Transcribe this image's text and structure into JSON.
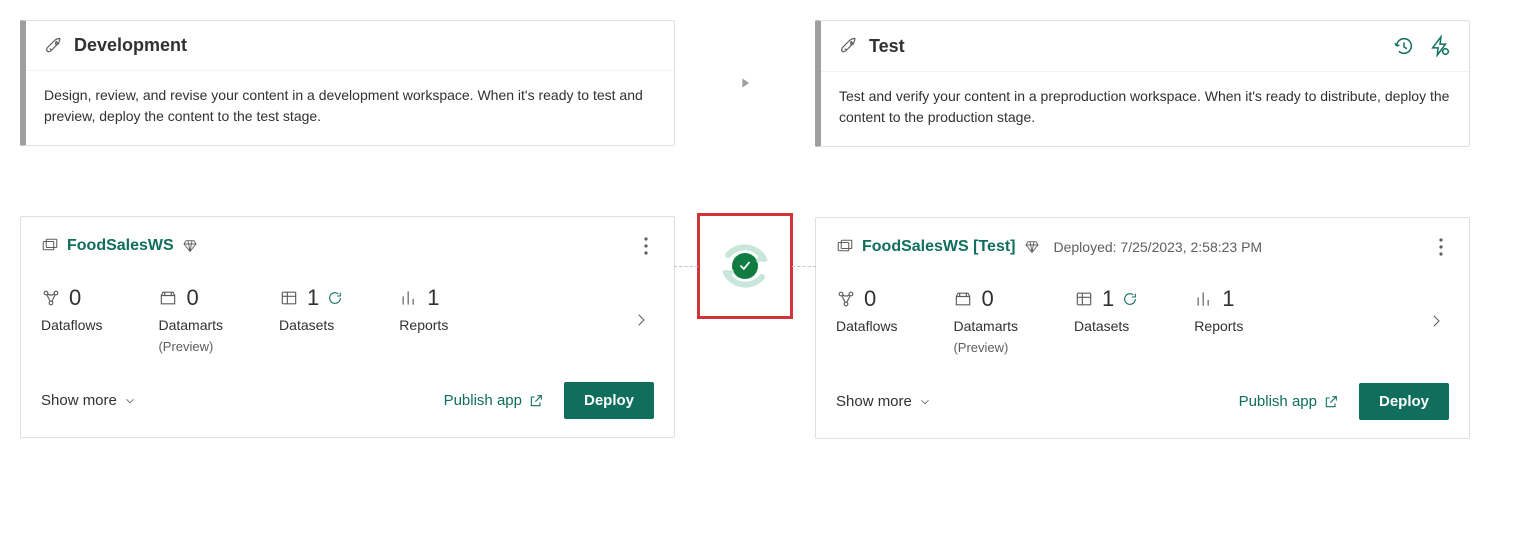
{
  "stages": {
    "dev": {
      "title": "Development",
      "description": "Design, review, and revise your content in a development workspace. When it's ready to test and preview, deploy the content to the test stage."
    },
    "test": {
      "title": "Test",
      "description": "Test and verify your content in a preproduction workspace. When it's ready to distribute, deploy the content to the production stage."
    }
  },
  "workspaces": {
    "dev": {
      "name": "FoodSalesWS",
      "metrics": {
        "dataflows": {
          "value": "0",
          "label": "Dataflows"
        },
        "datamarts": {
          "value": "0",
          "label": "Datamarts",
          "sublabel": "(Preview)"
        },
        "datasets": {
          "value": "1",
          "label": "Datasets"
        },
        "reports": {
          "value": "1",
          "label": "Reports"
        }
      }
    },
    "test": {
      "name": "FoodSalesWS [Test]",
      "deployed": "Deployed: 7/25/2023, 2:58:23 PM",
      "metrics": {
        "dataflows": {
          "value": "0",
          "label": "Dataflows"
        },
        "datamarts": {
          "value": "0",
          "label": "Datamarts",
          "sublabel": "(Preview)"
        },
        "datasets": {
          "value": "1",
          "label": "Datasets"
        },
        "reports": {
          "value": "1",
          "label": "Reports"
        }
      }
    }
  },
  "actions": {
    "show_more": "Show more",
    "publish_app": "Publish app",
    "deploy": "Deploy"
  }
}
